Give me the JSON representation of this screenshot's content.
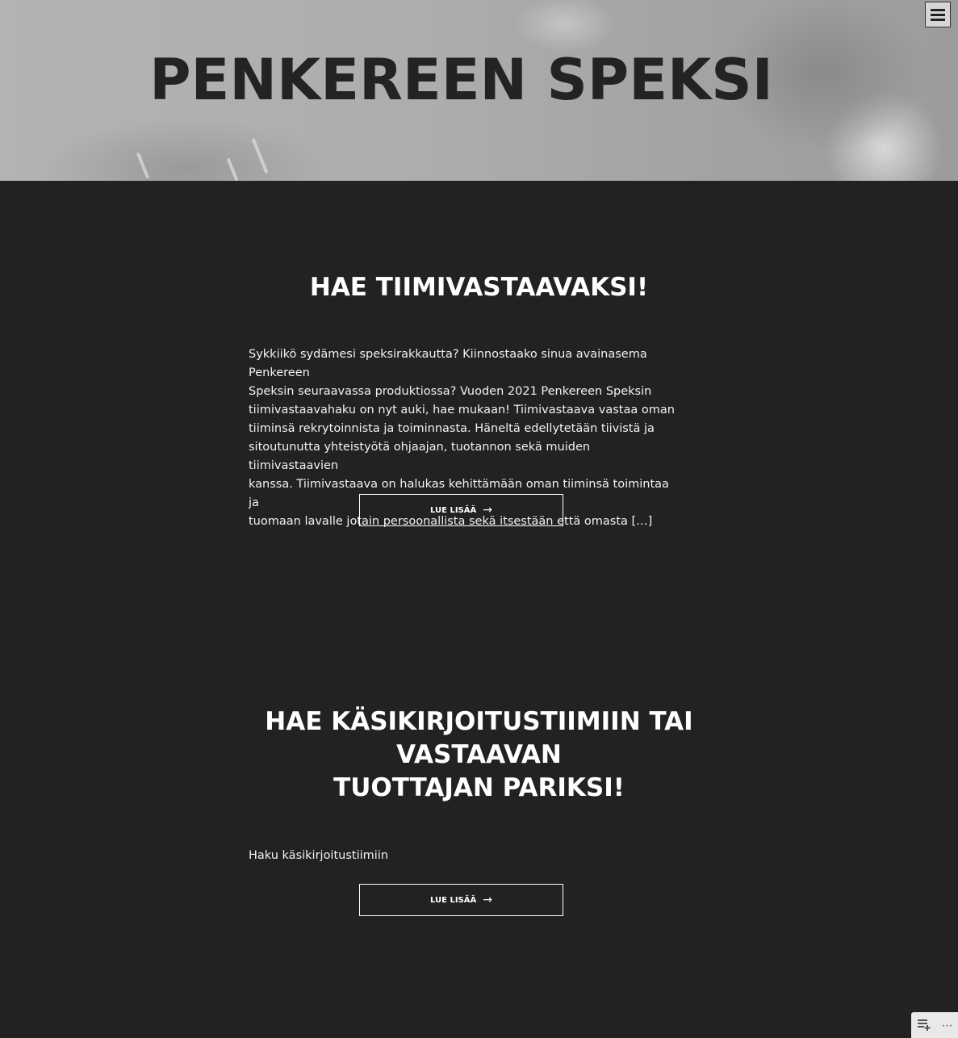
{
  "header": {
    "site_title": "PENKEREEN SPEKSI",
    "menu_icon": "hamburger-icon"
  },
  "posts": [
    {
      "title": "HAE TIIMIVASTAAVAKSI!",
      "excerpt_lines": [
        "Sykkiikö sydämesi speksirakkautta? Kiinnostaako sinua avainasema Penkereen",
        "Speksin seuraavassa produktiossa? Vuoden 2021 Penkereen Speksin",
        "tiimivastaavahaku on nyt auki, hae mukaan! Tiimivastaava vastaa oman",
        "tiiminsä rekrytoinnista ja toiminnasta. Häneltä edellytetään tiivistä ja",
        "sitoutunutta yhteistyötä ohjaajan, tuotannon sekä muiden tiimivastaavien",
        "kanssa. Tiimivastaava on halukas kehittämään oman tiiminsä toimintaa ja",
        "tuomaan lavalle jotain persoonallista sekä itsestään että omasta […]"
      ],
      "more_label": "LUE LISÄÄ",
      "more_arrow": "→"
    },
    {
      "title_lines": [
        "HAE KÄSIKIRJOITUSTIIMIIN TAI",
        "VASTAAVAN",
        "TUOTTAJAN PARIKSI!"
      ],
      "excerpt": "Haku käsikirjoitustiimiin",
      "more_label": "LUE LISÄÄ",
      "more_arrow": "→"
    }
  ],
  "admin_widget": {
    "icons": [
      "reader-icon",
      "more-dots-icon"
    ],
    "dots": "⋯"
  }
}
